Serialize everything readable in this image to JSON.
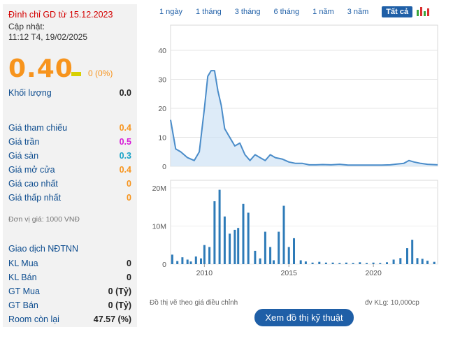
{
  "stock": {
    "suspend_notice": "Đình chỉ GD từ 15.12.2023",
    "updated_label": "Cập nhật:",
    "updated_time": "11:12 T4, 19/02/2025",
    "price": "0.40",
    "change": "0 (0%)"
  },
  "stats": [
    {
      "label": "Khối lượng",
      "value": "0.0"
    },
    {
      "label": "Giá tham chiếu",
      "value": "0.4"
    },
    {
      "label": "Giá trần",
      "value": "0.5"
    },
    {
      "label": "Giá sàn",
      "value": "0.3"
    },
    {
      "label": "Giá mở cửa",
      "value": "0.4"
    },
    {
      "label": "Giá cao nhất",
      "value": "0"
    },
    {
      "label": "Giá thấp nhất",
      "value": "0"
    }
  ],
  "unit_note": "Đơn vị giá: 1000 VNĐ",
  "foreign": {
    "title": "Giao dịch NĐTNN",
    "rows": [
      {
        "label": "KL Mua",
        "value": "0"
      },
      {
        "label": "KL Bán",
        "value": "0"
      },
      {
        "label": "GT Mua",
        "value": "0 (Tỷ)"
      },
      {
        "label": "GT Bán",
        "value": "0 (Tỷ)"
      },
      {
        "label": "Room còn lại",
        "value": "47.57 (%)"
      }
    ]
  },
  "tabs": [
    "1 ngày",
    "1 tháng",
    "3 tháng",
    "6 tháng",
    "1 năm",
    "3 năm",
    "Tất cả"
  ],
  "active_tab": "Tất cả",
  "chart_note": "Đồ thị vẽ theo giá điều chỉnh",
  "volume_unit": "đv KLg: 10,000cp",
  "tech_button": "Xem đồ thị kỹ thuật",
  "colors": {
    "accent": "#1f5fa7",
    "price": "#f7941d",
    "suspend": "#d40000",
    "line": "#4a8cc9"
  },
  "chart_data": [
    {
      "type": "area",
      "yticks": [
        0,
        10,
        20,
        30,
        40
      ],
      "ylim": [
        0,
        40
      ],
      "xlim": [
        2008.0,
        2023.8
      ],
      "grid": true,
      "x": [
        2008.0,
        2008.3,
        2008.6,
        2009.0,
        2009.4,
        2009.7,
        2010.0,
        2010.2,
        2010.4,
        2010.6,
        2010.8,
        2011.0,
        2011.2,
        2011.5,
        2011.8,
        2012.1,
        2012.4,
        2012.7,
        2013.0,
        2013.3,
        2013.6,
        2013.9,
        2014.2,
        2014.6,
        2015.0,
        2015.4,
        2015.8,
        2016.2,
        2016.6,
        2017.0,
        2017.5,
        2018.0,
        2018.5,
        2019.0,
        2019.5,
        2020.0,
        2020.5,
        2021.0,
        2021.4,
        2021.8,
        2022.1,
        2022.4,
        2022.8,
        2023.2,
        2023.5,
        2023.8
      ],
      "y": [
        16,
        6,
        5,
        3,
        2,
        5,
        20,
        31,
        33,
        33,
        26,
        21,
        13,
        10,
        7,
        8,
        4,
        2,
        4,
        3,
        2,
        4,
        3,
        2.5,
        1.5,
        1,
        1,
        0.5,
        0.5,
        0.6,
        0.5,
        0.7,
        0.4,
        0.4,
        0.4,
        0.4,
        0.4,
        0.5,
        0.8,
        1.0,
        2.0,
        1.5,
        1.0,
        0.7,
        0.6,
        0.5
      ]
    },
    {
      "type": "bar",
      "yticks": [
        "0",
        "10M",
        "20M"
      ],
      "ylim": [
        0,
        22000000
      ],
      "xticks": [
        "2010",
        "2015",
        "2020"
      ],
      "x": [
        2008.1,
        2008.4,
        2008.7,
        2009.0,
        2009.2,
        2009.5,
        2009.8,
        2010.0,
        2010.3,
        2010.6,
        2010.9,
        2011.2,
        2011.5,
        2011.8,
        2012.0,
        2012.3,
        2012.6,
        2013.0,
        2013.3,
        2013.6,
        2013.9,
        2014.1,
        2014.4,
        2014.7,
        2015.0,
        2015.3,
        2015.7,
        2016.0,
        2016.4,
        2016.8,
        2017.2,
        2017.6,
        2018.0,
        2018.4,
        2018.8,
        2019.2,
        2019.6,
        2020.0,
        2020.4,
        2020.8,
        2021.2,
        2021.6,
        2022.0,
        2022.3,
        2022.6,
        2022.9,
        2023.2,
        2023.6
      ],
      "values": [
        2500000,
        800000,
        1800000,
        1200000,
        700000,
        2000000,
        1500000,
        5000000,
        4500000,
        16500000,
        19500000,
        12500000,
        8000000,
        9000000,
        9500000,
        15800000,
        13500000,
        3500000,
        1500000,
        8500000,
        4500000,
        1000000,
        8500000,
        15300000,
        4500000,
        6800000,
        1000000,
        700000,
        400000,
        600000,
        400000,
        400000,
        300000,
        400000,
        300000,
        500000,
        300000,
        400000,
        300000,
        500000,
        1200000,
        1600000,
        4200000,
        6400000,
        1600000,
        1400000,
        900000,
        600000
      ]
    }
  ]
}
